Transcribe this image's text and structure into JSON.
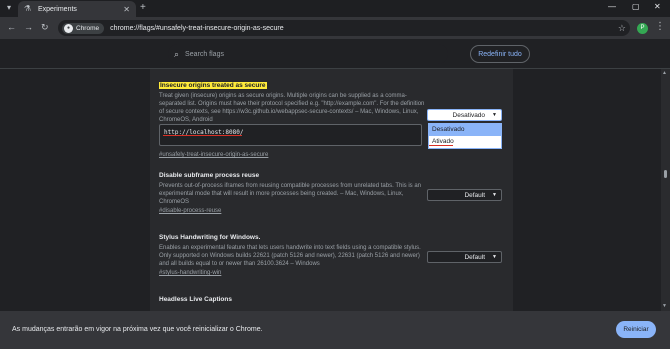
{
  "window": {
    "tab_title": "Experiments",
    "tab_icon": "flask-icon",
    "new_tab": "+",
    "minimize": "—",
    "maximize": "▢",
    "close": "✕"
  },
  "toolbar": {
    "chip_label": "Chrome",
    "url": "chrome://flags/#unsafely-treat-insecure-origin-as-secure",
    "avatar_letter": "P",
    "accent": "#8ab4f8"
  },
  "header": {
    "search_placeholder": "Search flags",
    "reset_all": "Redefinir tudo"
  },
  "flags": [
    {
      "title": "Insecure origins treated as secure",
      "description": "Treat given (insecure) origins as secure origins. Multiple origins can be supplied as a comma-separated list. Origins must have their protocol specified e.g. \"http://example.com\". For the definition of secure contexts, see https://w3c.github.io/webappsec-secure-contexts/ – Mac, Windows, Linux, ChromeOS, Android",
      "textarea_value": "http://localhost:8080/",
      "link": "#unsafely-treat-insecure-origin-as-secure",
      "select_value": "Desativado",
      "options": [
        "Desativado",
        "Ativado"
      ]
    },
    {
      "title": "Disable subframe process reuse",
      "description": "Prevents out-of-process iframes from reusing compatible processes from unrelated tabs. This is an experimental mode that will result in more processes being created. – Mac, Windows, Linux, ChromeOS",
      "link": "#disable-process-reuse",
      "select_value": "Default"
    },
    {
      "title": "Stylus Handwriting for Windows.",
      "description": "Enables an experimental feature that lets users handwrite into text fields using a compatible stylus. Only supported on Windows builds 22621 (patch 5126 and newer), 22631 (patch 5126 and newer) and all builds equal to or newer than 26100.3624 – Windows",
      "link": "#stylus-handwriting-win",
      "select_value": "Default"
    },
    {
      "title": "Headless Live Captions",
      "description": ""
    }
  ],
  "footer": {
    "message": "As mudanças entrarão em vigor na próxima vez que você reinicializar o Chrome.",
    "relaunch": "Reiniciar"
  }
}
